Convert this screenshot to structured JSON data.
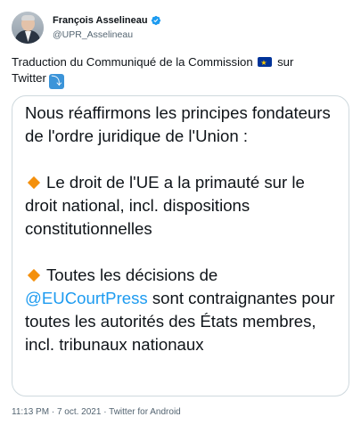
{
  "author": {
    "name": "François Asselineau",
    "handle": "@UPR_Asselineau"
  },
  "tweet": {
    "intro_line1": "Traduction du Communiqué de la Commission",
    "intro_line1_suffix": "sur",
    "intro_line2": "Twitter",
    "card": {
      "para1": "Nous réaffirmons les principes fondateurs de l'ordre juridique de l'Union :",
      "para2": "Le droit de l'UE a la primauté sur le droit national, incl. dispositions constitutionnelles",
      "para3_prefix": "Toutes les décisions de",
      "para3_mention": "@EUCourtPress",
      "para3_suffix": "sont contraignantes pour toutes les autorités des États membres, incl. tribunaux nationaux"
    },
    "meta": "11:13 PM · 7 oct. 2021 · Twitter for Android"
  },
  "icons": {
    "verified": "verified-badge-icon",
    "flag": "eu-flag-icon",
    "arrow": "right-arrow-curving-down-icon",
    "bullet": "orange-diamond-icon"
  },
  "colors": {
    "link": "#1d9bf0",
    "secondary_text": "#536471",
    "border": "#cfd9de",
    "diamond": "#f4900c"
  }
}
